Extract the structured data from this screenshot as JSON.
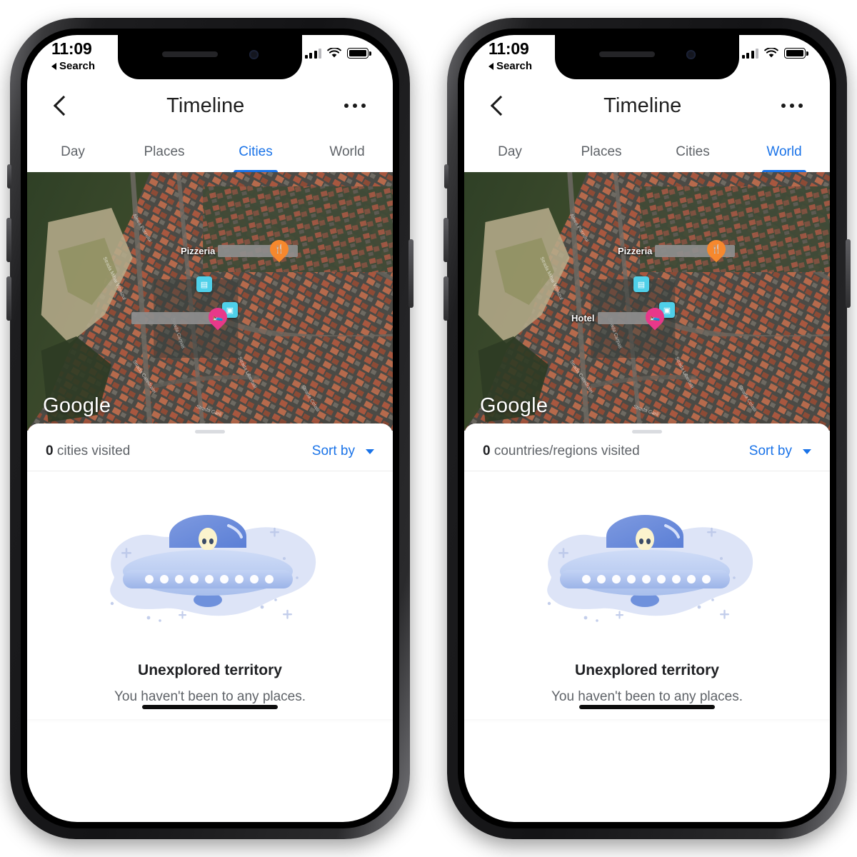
{
  "phones": [
    {
      "id": "left",
      "status_bar": {
        "time": "11:09",
        "back_label": "Search",
        "cellular_icon": "signal-bars-icon",
        "wifi_icon": "wifi-icon",
        "battery_icon": "battery-full-icon"
      },
      "app_bar": {
        "back_icon": "chevron-left-icon",
        "title": "Timeline",
        "overflow_icon": "more-horizontal-icon"
      },
      "tabs": [
        {
          "label": "Day",
          "active": false
        },
        {
          "label": "Places",
          "active": false
        },
        {
          "label": "Cities",
          "active": true
        },
        {
          "label": "World",
          "active": false
        }
      ],
      "map": {
        "watermark": "Google",
        "labels": [
          {
            "text": "Pizzeria",
            "redacted": true
          },
          {
            "text": "",
            "redacted": true
          }
        ],
        "pins": [
          {
            "type": "restaurant-pin",
            "color": "#f6882d",
            "glyph": "restaurant-icon"
          },
          {
            "type": "hotel-pin",
            "color": "#e8388a",
            "glyph": "hotel-icon"
          }
        ],
        "poi_badges": [
          {
            "icon": "transit-icon",
            "color": "#4fd0e9"
          },
          {
            "icon": "store-icon",
            "color": "#4fd0e9"
          }
        ]
      },
      "sheet": {
        "count": "0",
        "visited_label": "cities visited",
        "sort_label": "Sort by",
        "sort_caret_icon": "caret-down-icon",
        "grabber": "drag-handle"
      },
      "empty_state": {
        "illustration": "ufo-illustration",
        "title": "Unexplored territory",
        "subtitle": "You haven't been to any places."
      }
    },
    {
      "id": "right",
      "status_bar": {
        "time": "11:09",
        "back_label": "Search",
        "cellular_icon": "signal-bars-icon",
        "wifi_icon": "wifi-icon",
        "battery_icon": "battery-full-icon"
      },
      "app_bar": {
        "back_icon": "chevron-left-icon",
        "title": "Timeline",
        "overflow_icon": "more-horizontal-icon"
      },
      "tabs": [
        {
          "label": "Day",
          "active": false
        },
        {
          "label": "Places",
          "active": false
        },
        {
          "label": "Cities",
          "active": false
        },
        {
          "label": "World",
          "active": true
        }
      ],
      "map": {
        "watermark": "Google",
        "labels": [
          {
            "text": "Pizzeria",
            "redacted": true
          },
          {
            "text": "Hotel",
            "redacted": true
          }
        ],
        "pins": [
          {
            "type": "restaurant-pin",
            "color": "#f6882d",
            "glyph": "restaurant-icon"
          },
          {
            "type": "hotel-pin",
            "color": "#e8388a",
            "glyph": "hotel-icon"
          }
        ],
        "poi_badges": [
          {
            "icon": "transit-icon",
            "color": "#4fd0e9"
          },
          {
            "icon": "store-icon",
            "color": "#4fd0e9"
          }
        ]
      },
      "sheet": {
        "count": "0",
        "visited_label": "countries/regions visited",
        "sort_label": "Sort by",
        "sort_caret_icon": "caret-down-icon",
        "grabber": "drag-handle"
      },
      "empty_state": {
        "illustration": "ufo-illustration",
        "title": "Unexplored territory",
        "subtitle": "You haven't been to any places."
      }
    }
  ],
  "colors": {
    "accent_blue": "#1a73e8",
    "text_primary": "#202124",
    "text_secondary": "#5f6368",
    "hotel_pin": "#e8388a",
    "restaurant_pin": "#f6882d",
    "poi_cyan": "#4fd0e9",
    "illustration_blob": "#dde4f7",
    "illustration_body": "#bdcdf0"
  }
}
